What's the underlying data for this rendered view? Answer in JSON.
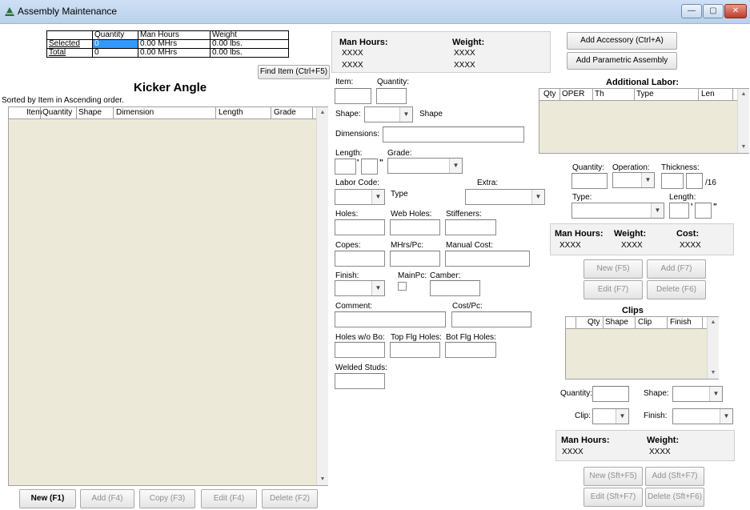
{
  "window": {
    "title": "Assembly Maintenance",
    "minimize": "—",
    "maximize": "▢",
    "close": "✕"
  },
  "summary": {
    "headers": [
      "Quantity",
      "Man Hours",
      "Weight"
    ],
    "rows": [
      {
        "label": "Selected",
        "quantity": "0",
        "man_hours": "0.00 MHrs",
        "weight": "0.00 lbs."
      },
      {
        "label": "Total",
        "quantity": "0",
        "man_hours": "0.00 MHrs",
        "weight": "0.00 lbs."
      }
    ]
  },
  "left": {
    "find_button": "Find Item (Ctrl+F5)",
    "heading": "Kicker Angle",
    "sort_text": "Sorted by Item in Ascending order.",
    "columns": [
      "Item",
      "Quantity",
      "Shape",
      "Dimension",
      "Length",
      "Grade"
    ],
    "buttons": {
      "new": "New (F1)",
      "add": "Add (F4)",
      "copy": "Copy (F3)",
      "edit": "Edit (F4)",
      "delete": "Delete (F2)"
    }
  },
  "totals": {
    "man_hours_label": "Man Hours:",
    "weight_label": "Weight:",
    "man_hours_1": "XXXX",
    "man_hours_2": "XXXX",
    "weight_1": "XXXX",
    "weight_2": "XXXX"
  },
  "top_buttons": {
    "add_accessory": "Add Accessory (Ctrl+A)",
    "add_parametric": "Add Parametric Assembly"
  },
  "form": {
    "item": "Item:",
    "quantity": "Quantity:",
    "shape": "Shape:",
    "shape_text": "Shape",
    "dimensions": "Dimensions:",
    "length": "Length:",
    "grade": "Grade:",
    "feet_mark": "'",
    "inch_mark": "\"",
    "labor_code": "Labor Code:",
    "extra": "Extra:",
    "type_text": "Type",
    "holes": "Holes:",
    "web_holes": "Web Holes:",
    "stiffeners": "Stiffeners:",
    "copes": "Copes:",
    "mhrs_pc": "MHrs/Pc:",
    "manual_cost": "Manual Cost:",
    "finish": "Finish:",
    "mainpc": "MainPc:",
    "camber": "Camber:",
    "comment": "Comment:",
    "cost_pc": "Cost/Pc:",
    "holes_wo_bo": "Holes w/o Bo:",
    "top_flg_holes": "Top Flg Holes:",
    "bot_flg_holes": "Bot Flg Holes:",
    "welded_studs": "Welded Studs:"
  },
  "labor": {
    "heading": "Additional Labor:",
    "columns": [
      "Qty",
      "OPER",
      "Th",
      "Type",
      "Len"
    ],
    "quantity": "Quantity:",
    "operation": "Operation:",
    "thickness": "Thickness:",
    "sixteenths": "/16",
    "type": "Type:",
    "length": "Length:",
    "feet_mark": "'",
    "inch_mark": "\"",
    "man_hours_label": "Man Hours:",
    "weight_label": "Weight:",
    "cost_label": "Cost:",
    "man_hours": "XXXX",
    "weight": "XXXX",
    "cost": "XXXX",
    "buttons": {
      "new": "New (F5)",
      "add": "Add (F7)",
      "edit": "Edit (F7)",
      "delete": "Delete (F6)"
    }
  },
  "clips": {
    "heading": "Clips",
    "columns": [
      "Qty",
      "Shape",
      "Clip",
      "Finish"
    ],
    "quantity": "Quantity:",
    "shape": "Shape:",
    "clip": "Clip:",
    "finish": "Finish:",
    "man_hours_label": "Man Hours:",
    "weight_label": "Weight:",
    "man_hours": "XXXX",
    "weight": "XXXX",
    "buttons": {
      "new": "New (Sft+F5)",
      "add": "Add (Sft+F7)",
      "edit": "Edit (Sft+F7)",
      "delete": "Delete (Sft+F6)"
    }
  },
  "colors": {
    "selection": "#3399ff",
    "titlebar": "#c4d8ef",
    "grid_body": "#ece9d8"
  }
}
